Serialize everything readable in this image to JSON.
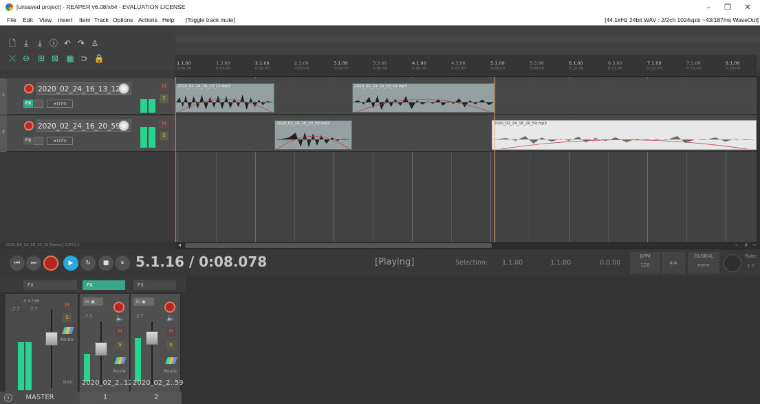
{
  "window": {
    "title": "[unsaved project] - REAPER v6.08/x64 - EVALUATION LICENSE",
    "min_glyph": "–",
    "max_glyph": "❐",
    "close_glyph": "✕"
  },
  "menu": {
    "items": [
      "File",
      "Edit",
      "View",
      "Insert",
      "Item",
      "Track",
      "Options",
      "Actions",
      "Help"
    ],
    "action_hint": "[Toggle track mute]",
    "audio_status": "[44.1kHz 24bit WAV : 2/2ch 1024spls ~43/187ms WaveOut]"
  },
  "ruler": {
    "marks": [
      {
        "label": "1.1.00",
        "time": "0:00.00",
        "major": true
      },
      {
        "label": "1.3.00",
        "time": "0:01.00",
        "major": false
      },
      {
        "label": "2.1.00",
        "time": "0:02.00",
        "major": true
      },
      {
        "label": "2.3.00",
        "time": "0:03.00",
        "major": false
      },
      {
        "label": "3.1.00",
        "time": "0:04.00",
        "major": true
      },
      {
        "label": "3.3.00",
        "time": "0:05.00",
        "major": false
      },
      {
        "label": "4.1.00",
        "time": "0:06.00",
        "major": true
      },
      {
        "label": "4.3.00",
        "time": "0:07.00",
        "major": false
      },
      {
        "label": "5.1.00",
        "time": "0:08.00",
        "major": true
      },
      {
        "label": "5.3.00",
        "time": "0:09.00",
        "major": false
      },
      {
        "label": "6.1.00",
        "time": "0:10.00",
        "major": true
      },
      {
        "label": "6.3.00",
        "time": "0:11.00",
        "major": false
      },
      {
        "label": "7.1.00",
        "time": "0:12.00",
        "major": true
      },
      {
        "label": "7.3.00",
        "time": "0:13.00",
        "major": false
      },
      {
        "label": "8.1.00",
        "time": "0:14.00",
        "major": true
      }
    ]
  },
  "tracks": [
    {
      "number": "1",
      "name": "2020_02_24_16_13_12",
      "fx_label": "FX",
      "trim_label": "trim",
      "mute": "M",
      "solo": "S"
    },
    {
      "number": "2",
      "name": "2020_02_24_16_20_59",
      "fx_label": "FX",
      "trim_label": "trim",
      "mute": "M",
      "solo": "S"
    }
  ],
  "items": [
    {
      "name": "2020_02_24_16_13_12.mp3",
      "track": 1
    },
    {
      "name": "2020_02_24_16_13_12.mp3",
      "track": 1
    },
    {
      "name": "2020_02_24_16_20_59.mp3",
      "track": 2
    },
    {
      "name": "2020_02_24_16_20_59.mp3",
      "track": 2
    }
  ],
  "status_line": "2020_02_24_16_13_12 [Items] 2 [FX] 1",
  "transport": {
    "position": "5.1.16 / 0:08.078",
    "state": "[Playing]",
    "selection_label": "Selection:",
    "sel_start": "1.1.00",
    "sel_end": "1.1.00",
    "sel_length": "0.0.00",
    "bpm_label": "BPM",
    "bpm": "120",
    "time_sig": "4/4",
    "global_label": "GLOBAL",
    "global_value": "none",
    "rate_label": "Rate:",
    "rate_value": "1.0"
  },
  "mixer": {
    "fx_label": "FX",
    "master": {
      "volume": "-5.07dB",
      "peak_l": "-7.7",
      "peak_r": "-7.7",
      "route": "Route",
      "trim": "trim",
      "name": "MASTER",
      "mute": "M",
      "solo": "S",
      "footer_num": "1"
    },
    "strips": [
      {
        "in_label": "in",
        "vol": "-7.5",
        "route": "Route",
        "name": "2020_02_2..12",
        "footer": "1",
        "mute": "M",
        "solo": "S"
      },
      {
        "in_label": "in",
        "vol": "-2.7",
        "route": "Route",
        "name": "2020_02_2..59",
        "footer": "2",
        "mute": "M",
        "solo": "S"
      }
    ]
  },
  "colors": {
    "accent_green": "#26d490",
    "record_red": "#b4261d",
    "play_blue": "#29a9df",
    "cursor_gold": "#d7b54a"
  }
}
